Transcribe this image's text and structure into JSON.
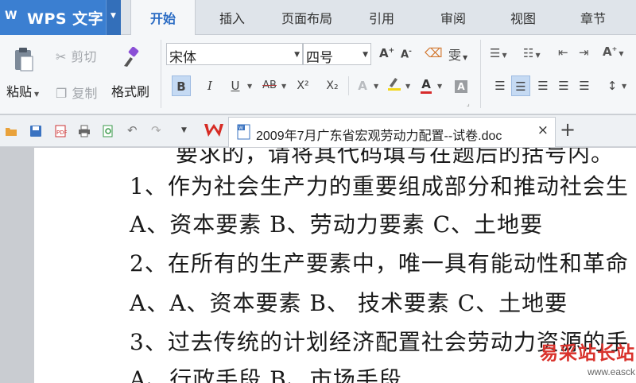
{
  "app": {
    "logo": "W",
    "title": "WPS 文字"
  },
  "tabs": [
    "开始",
    "插入",
    "页面布局",
    "引用",
    "审阅",
    "视图",
    "章节"
  ],
  "active_tab": "开始",
  "ribbon": {
    "paste_label": "粘贴",
    "cut_label": "剪切",
    "copy_label": "复制",
    "format_painter_label": "格式刷",
    "font_name": "宋体",
    "font_size": "四号",
    "bold": "B",
    "italic": "I",
    "underline": "U",
    "strikethrough": "AB",
    "superscript": "X²",
    "subscript": "X₂",
    "phonetic_glyph": "雯"
  },
  "document_tab": {
    "filename": "2009年7月广东省宏观劳动力配置--试卷.doc",
    "close": "×"
  },
  "new_tab": "+",
  "document": {
    "lines": [
      "要求的，请将其代码填写在题后的括号内。",
      "1、作为社会生产力的重要组成部分和推动社会生",
      "A、资本要素      B、劳动力要素        C、土地要",
      "2、在所有的生产要素中，唯一具有能动性和革命",
      "A、A、资本要素      B、 技术要素    C、土地要",
      "3、过去传统的计划经济配置社会劳动力资源的手",
      "A、行政手段        B、市场手段"
    ]
  },
  "watermark": {
    "cn": "易采站长站",
    "url": "www.easck.com"
  },
  "colors": {
    "brand": "#3b7fd1",
    "active_tab_text": "#2b6cc4",
    "watermark": "#d9322c"
  }
}
